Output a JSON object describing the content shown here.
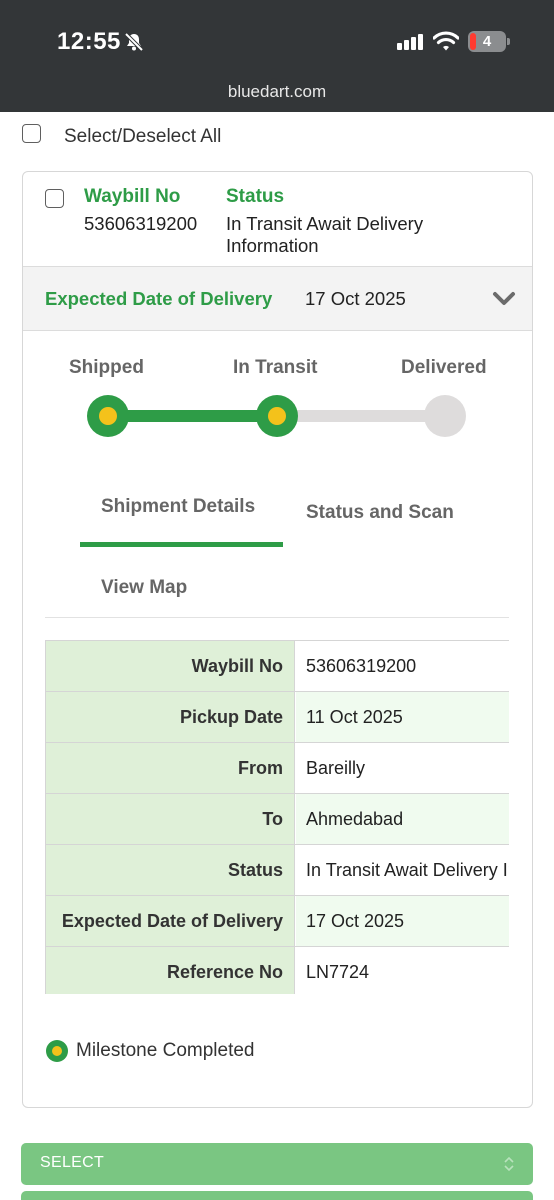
{
  "status_bar": {
    "time": "12:55",
    "battery_level": "4",
    "icons": [
      "bell-slash-icon",
      "signal-icon",
      "wifi-icon",
      "battery-icon"
    ]
  },
  "browser": {
    "url": "bluedart.com"
  },
  "select_all": {
    "label": "Select/Deselect All",
    "checked": false
  },
  "shipment": {
    "checked": false,
    "waybill_header": "Waybill No",
    "waybill_value": "53606319200",
    "status_header": "Status",
    "status_value": "In Transit Await Delivery Information",
    "edd_label": "Expected Date of Delivery",
    "edd_value": "17 Oct 2025"
  },
  "progress": {
    "steps": [
      {
        "label": "Shipped",
        "completed": true
      },
      {
        "label": "In Transit",
        "completed": true
      },
      {
        "label": "Delivered",
        "completed": false
      }
    ],
    "colors": {
      "completed": "#2e9c47",
      "dot": "#f4c21b",
      "pending": "#dedcdc"
    }
  },
  "tabs": [
    {
      "label": "Shipment Details",
      "active": true
    },
    {
      "label": "Status and Scan",
      "active": false
    },
    {
      "label": "View Map",
      "active": false
    }
  ],
  "details": [
    {
      "key": "Waybill No",
      "value": "53606319200"
    },
    {
      "key": "Pickup Date",
      "value": "11 Oct 2025"
    },
    {
      "key": "From",
      "value": "Bareilly"
    },
    {
      "key": "To",
      "value": "Ahmedabad"
    },
    {
      "key": "Status",
      "value": "In Transit Await Delivery Information"
    },
    {
      "key": "Expected Date of Delivery",
      "value": "17 Oct 2025"
    },
    {
      "key": "Reference No",
      "value": "LN7724"
    }
  ],
  "legend": {
    "label": "Milestone Completed"
  },
  "select": {
    "label": "SELECT"
  },
  "colors": {
    "accent": "#2e9c47",
    "key_bg": "#dff0d8",
    "select_bg": "#7ac682"
  }
}
